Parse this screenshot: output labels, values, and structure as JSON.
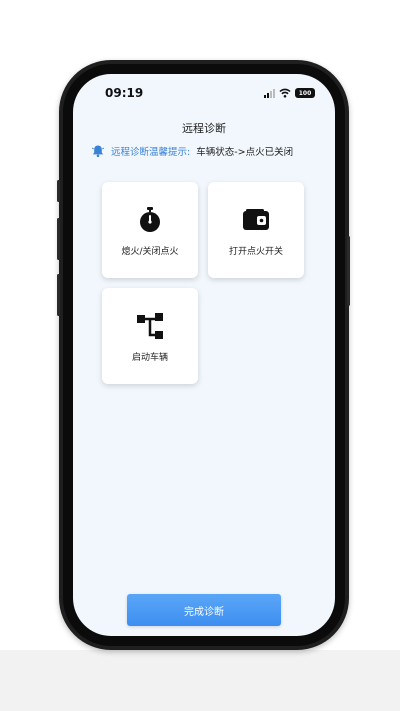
{
  "status_bar": {
    "time": "09:19",
    "battery": "100"
  },
  "page": {
    "title": "远程诊断"
  },
  "notice": {
    "prefix": "远程诊断温馨提示:",
    "message": "车辆状态->点火已关闭"
  },
  "actions": [
    {
      "label": "熄火/关闭点火",
      "icon": "stopwatch-icon"
    },
    {
      "label": "打开点火开关",
      "icon": "wallet-icon"
    },
    {
      "label": "启动车辆",
      "icon": "flow-connector-icon"
    }
  ],
  "footer": {
    "done_label": "完成诊断"
  },
  "colors": {
    "accent": "#3d8ef0",
    "notice_blue": "#3a82d6",
    "screen_bg": "#f1f7fd"
  }
}
